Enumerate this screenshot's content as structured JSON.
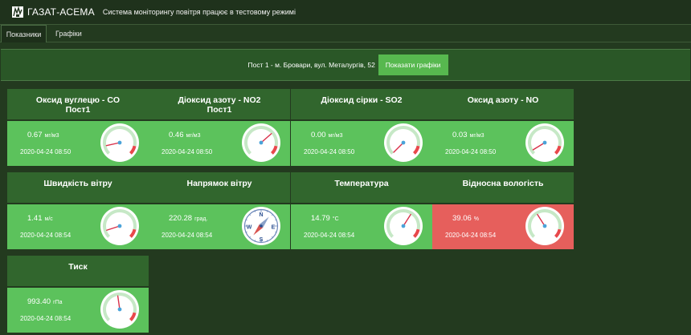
{
  "header": {
    "brand": "ГАЗАТ-АСЕМА",
    "message": "Система моніторингу повітря працює в тестовому режимі"
  },
  "tabs": [
    {
      "label": "Показники"
    },
    {
      "label": "Графіки"
    }
  ],
  "station": {
    "label": "Пост 1 - м. Бровари, вул. Металургів, 52",
    "button_label": "Показати графіки"
  },
  "colors": {
    "ok": "#5cc25c",
    "alert": "#e65f5c",
    "header": "#31662d",
    "accent": "#57b84f"
  },
  "cards": [
    {
      "title": "Оксид вуглецю - CO",
      "subtitle": "Пост1",
      "value": "0.67",
      "unit": "мг/м3",
      "time": "2020-04-24 08:50",
      "gauge_level": 0.12,
      "status": "ok"
    },
    {
      "title": "Діоксид азоту - NO2",
      "subtitle": "Пост1",
      "value": "0.46",
      "unit": "мг/м3",
      "time": "2020-04-24 08:50",
      "gauge_level": 0.68,
      "status": "ok"
    },
    {
      "title": "Діоксид сірки - SO2",
      "subtitle": "",
      "value": "0.00",
      "unit": "мг/м3",
      "time": "2020-04-24 08:50",
      "gauge_level": 0.0,
      "status": "ok"
    },
    {
      "title": "Оксид азоту - NO",
      "subtitle": "",
      "value": "0.03",
      "unit": "мг/м3",
      "time": "2020-04-24 08:50",
      "gauge_level": 0.05,
      "status": "ok"
    },
    {
      "title": "Швидкість вітру",
      "subtitle": "",
      "value": "1.41",
      "unit": "м/с",
      "time": "2020-04-24 08:54",
      "gauge_level": 0.1,
      "status": "ok"
    },
    {
      "title": "Напрямок вітру",
      "subtitle": "",
      "value": "220.28",
      "unit": "град.",
      "time": "2020-04-24 08:54",
      "compass": true,
      "compass_deg": 220.28,
      "compass_labels": [
        "N",
        "E",
        "S",
        "W"
      ],
      "status": "ok"
    },
    {
      "title": "Температура",
      "subtitle": "",
      "value": "14.79",
      "unit": "°C",
      "time": "2020-04-24 08:54",
      "gauge_level": 0.62,
      "status": "ok"
    },
    {
      "title": "Відносна вологість",
      "subtitle": "",
      "value": "39.06",
      "unit": "%",
      "time": "2020-04-24 08:54",
      "gauge_level": 0.38,
      "status": "alert"
    },
    {
      "title": "Тиск",
      "subtitle": "",
      "value": "993.40",
      "unit": "гПа",
      "time": "2020-04-24 08:54",
      "gauge_level": 0.47,
      "status": "ok"
    }
  ]
}
